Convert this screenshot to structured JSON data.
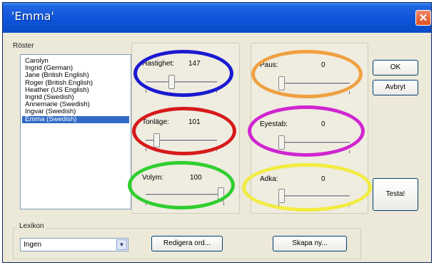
{
  "window": {
    "title": "'Emma'"
  },
  "voices": {
    "label": "Röster",
    "items": [
      "Carolyn",
      "Ingrid (German)",
      "Jane (British English)",
      "Roger (British English)",
      "Heather (US English)",
      "Ingrid (Swedish)",
      "Annemarie (Swedish)",
      "Ingvar (Swedish)",
      "Emma (Swedish)"
    ],
    "selected": "Emma (Swedish)"
  },
  "sliders": {
    "hastighet": {
      "label": "Hastighet:",
      "value": "147",
      "level": 0.35,
      "highlight": "#1a1ad0"
    },
    "tonlage": {
      "label": "Tonläge:",
      "value": "101",
      "level": 0.12,
      "highlight": "#d61a1a"
    },
    "volym": {
      "label": "Volym:",
      "value": "100",
      "level": 1.0,
      "highlight": "#2fce2f"
    },
    "paus": {
      "label": "Paus:",
      "value": "0",
      "level": 0.0,
      "highlight": "#f0a040"
    },
    "eyeslab": {
      "label": "Eyestab:",
      "value": "0",
      "level": 0.0,
      "highlight": "#d025d0"
    },
    "adka": {
      "label": "Adka:",
      "value": "0",
      "level": 0.0,
      "highlight": "#f2ec40"
    }
  },
  "buttons": {
    "ok": "OK",
    "cancel": "Avbryt",
    "test": "Testa!",
    "edit_lexicon": "Redigera ord...",
    "create_new": "Skapa ny..."
  },
  "lexicon": {
    "label": "Lexikon",
    "value": "Ingen"
  }
}
